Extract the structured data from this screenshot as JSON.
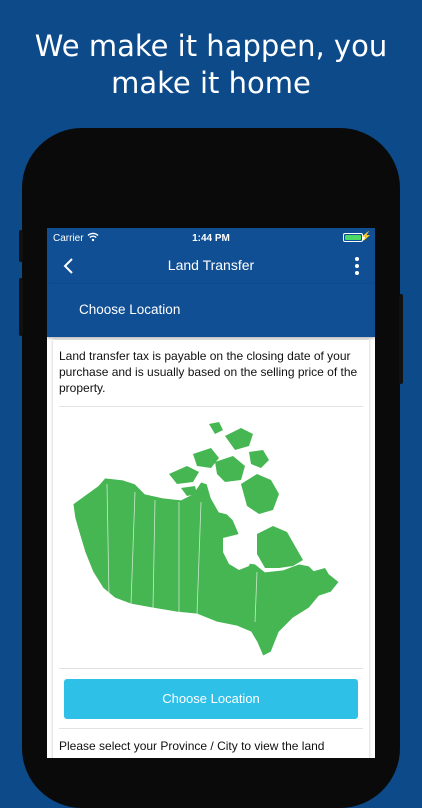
{
  "promo": {
    "headline_line1": "We make it happen, you",
    "headline_line2": "make it home"
  },
  "status_bar": {
    "carrier": "Carrier",
    "time": "1:44 PM",
    "battery_color": "#4cd964"
  },
  "nav": {
    "title": "Land Transfer",
    "back_icon": "chevron-left-icon",
    "more_icon": "vertical-ellipsis-icon"
  },
  "section": {
    "title": "Choose Location"
  },
  "content": {
    "intro": "Land transfer tax is payable on the closing date of your purchase and is usually based on the selling price of the property.",
    "map_image": "canada-map",
    "map_color": "#46b653",
    "button_label": "Choose Location",
    "footer_text": "Please select your Province / City to view the land"
  },
  "colors": {
    "background": "#0c4a8a",
    "bar": "#104f94",
    "button": "#2fc0e8"
  }
}
